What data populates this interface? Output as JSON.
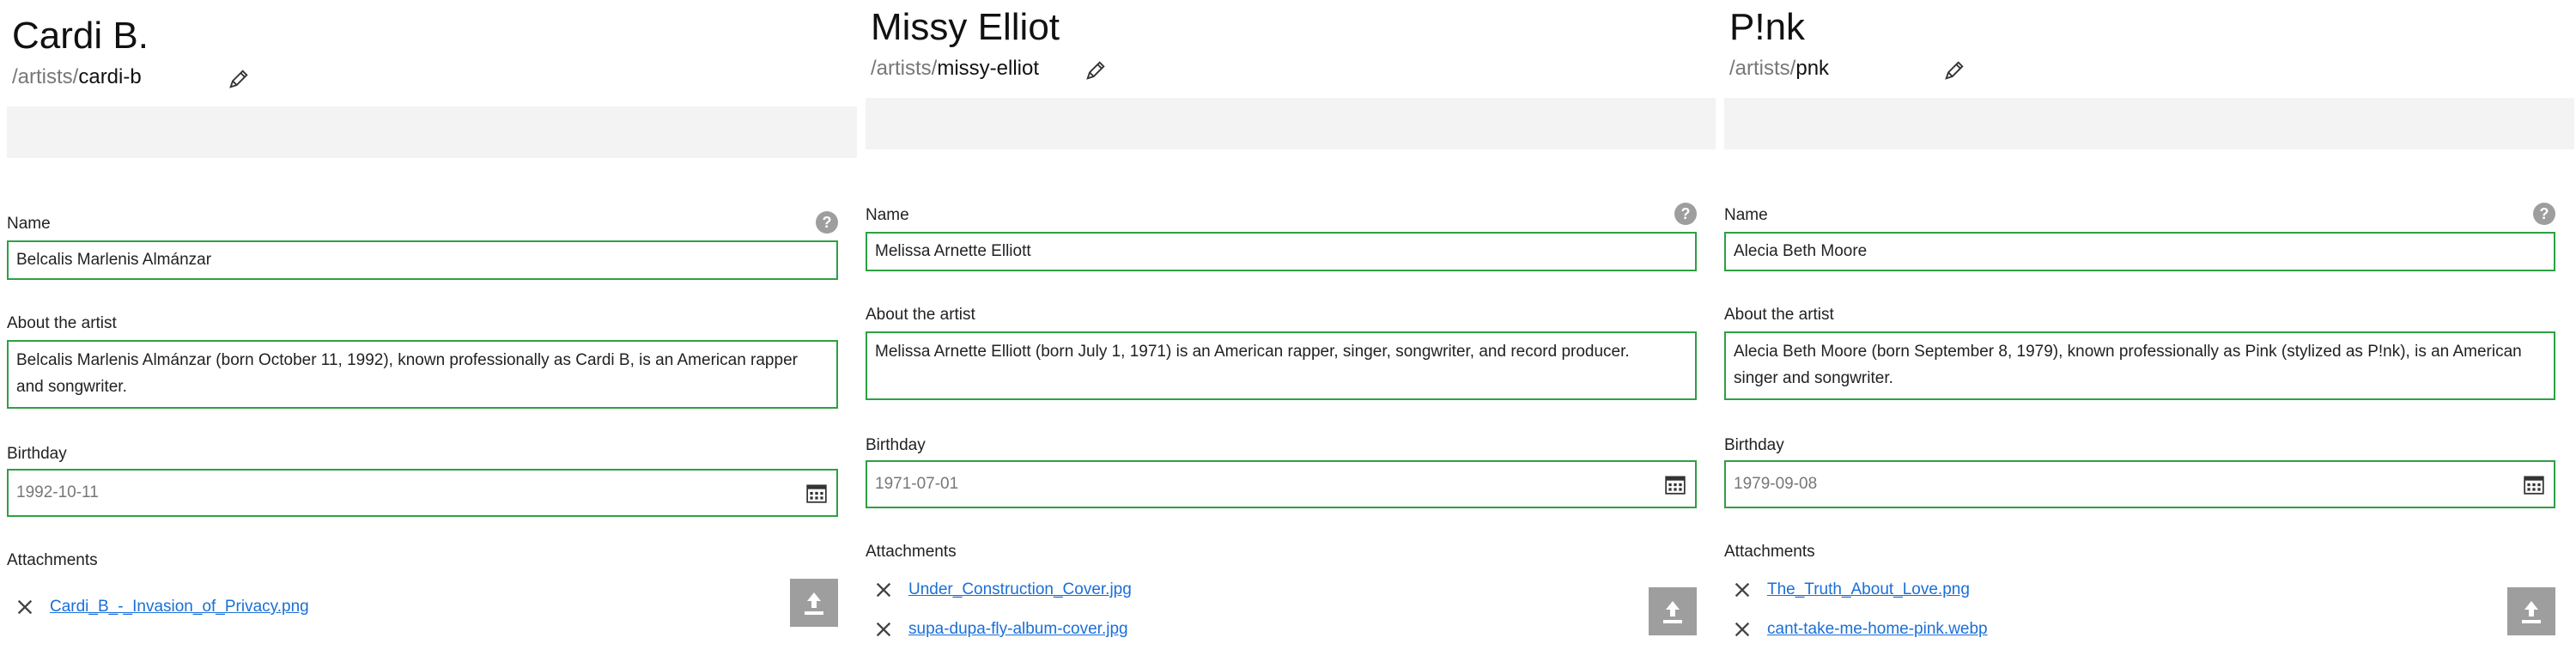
{
  "panels": [
    {
      "title": "Cardi B.",
      "slug_prefix": "/artists/",
      "slug": "cardi-b",
      "name_label": "Name",
      "name_value": "Belcalis Marlenis Almánzar",
      "about_label": "About the artist",
      "about_value": "Belcalis Marlenis Almánzar (born October 11, 1992), known professionally as Cardi B, is an American rapper and songwriter.",
      "birthday_label": "Birthday",
      "birthday_value": "1992-10-11",
      "attachments_label": "Attachments",
      "attachments": [
        "Cardi_B_-_Invasion_of_Privacy.png"
      ],
      "help_glyph": "?"
    },
    {
      "title": "Missy Elliot",
      "slug_prefix": "/artists/",
      "slug": "missy-elliot",
      "name_label": "Name",
      "name_value": "Melissa Arnette Elliott",
      "about_label": "About the artist",
      "about_value": "Melissa Arnette Elliott (born July 1, 1971) is an American rapper, singer, songwriter, and record producer.",
      "birthday_label": "Birthday",
      "birthday_value": "1971-07-01",
      "attachments_label": "Attachments",
      "attachments": [
        "Under_Construction_Cover.jpg",
        "supa-dupa-fly-album-cover.jpg"
      ],
      "help_glyph": "?"
    },
    {
      "title": "P!nk",
      "slug_prefix": "/artists/",
      "slug": "pnk",
      "name_label": "Name",
      "name_value": "Alecia Beth Moore",
      "about_label": "About the artist",
      "about_value": "Alecia Beth Moore (born September 8, 1979), known professionally as Pink (stylized as P!nk), is an American singer and songwriter.",
      "birthday_label": "Birthday",
      "birthday_value": "1979-09-08",
      "attachments_label": "Attachments",
      "attachments": [
        "The_Truth_About_Love.png",
        "cant-take-me-home-pink.webp"
      ],
      "help_glyph": "?"
    }
  ],
  "colors": {
    "field_border": "#2ea043",
    "link": "#1a6fd8",
    "banner": "#f3f3f3",
    "icon_button": "#9e9e9e"
  },
  "icons": {
    "edit": "pencil-icon",
    "help": "help-icon",
    "calendar": "calendar-icon",
    "remove": "close-icon",
    "upload": "upload-icon"
  }
}
